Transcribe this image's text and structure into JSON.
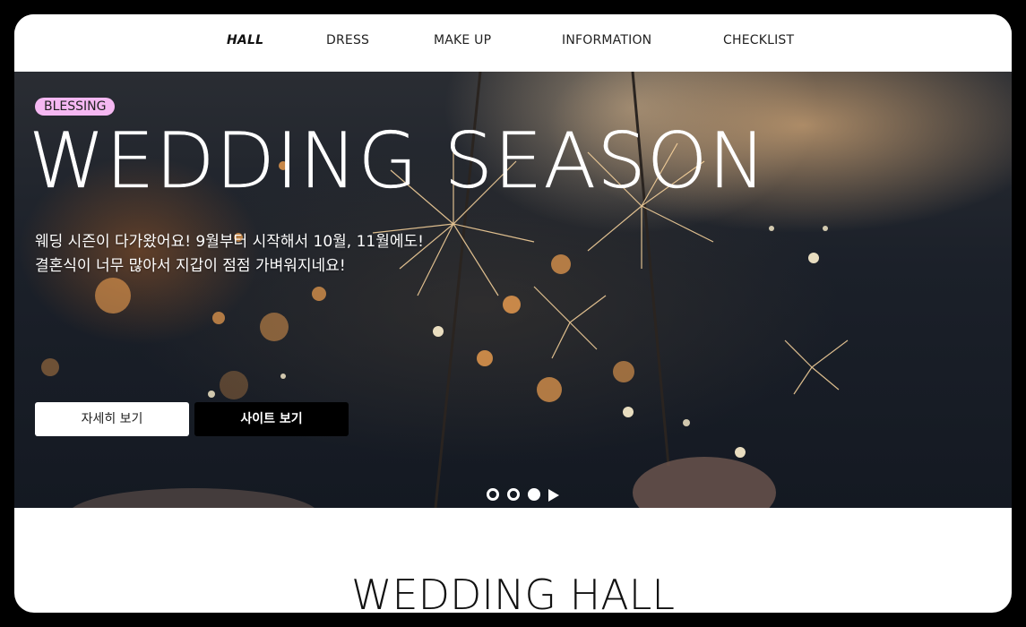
{
  "nav": {
    "items": [
      {
        "label": "HALL",
        "active": true
      },
      {
        "label": "DRESS",
        "active": false
      },
      {
        "label": "MAKE UP",
        "active": false
      },
      {
        "label": "INFORMATION",
        "active": false
      },
      {
        "label": "CHECKLIST",
        "active": false
      }
    ]
  },
  "hero": {
    "badge": "BLESSING",
    "title": "WEDDING SEASON",
    "text_line1": "웨딩 시즌이 다가왔어요! 9월부터 시작해서 10월, 11월에도!",
    "text_line2": "결혼식이 너무 많아서 지갑이 점점 가벼워지네요!",
    "buttons": {
      "detail": "자세히 보기",
      "site": "사이트 보기"
    },
    "slider": {
      "total_slides": 3,
      "current_slide": 3,
      "play_icon": "play-icon"
    }
  },
  "section": {
    "title": "WEDDING HALL"
  },
  "colors": {
    "badge": "#f5b8f2",
    "frame": "#000000",
    "button_light": "#ffffff",
    "button_dark": "#000000"
  }
}
